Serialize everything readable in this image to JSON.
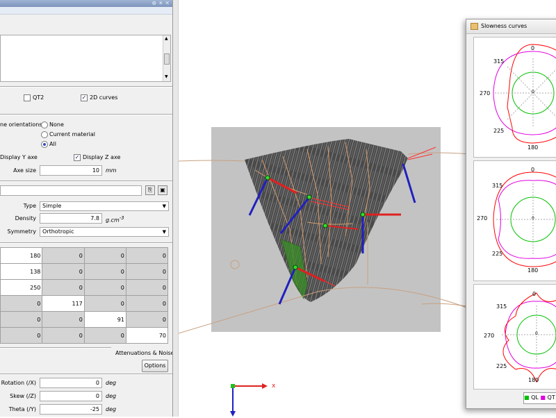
{
  "left_panel": {
    "titlebar_buttons": "⊕ ☀ ✕",
    "curves": {
      "qt2": "QT2",
      "curves_2d": "2D curves"
    },
    "orientations": {
      "label": "ne orientations",
      "none": "None",
      "current": "Current material",
      "all": "All"
    },
    "display": {
      "y": "Display Y axe",
      "z": "Display Z axe"
    },
    "axe_size": {
      "label": "Axe size",
      "value": "10",
      "unit": "mm"
    },
    "material": {
      "type_label": "Type",
      "type_value": "Simple",
      "density_label": "Density",
      "density_value": "7.8",
      "density_unit": "g.cm",
      "symmetry_label": "Symmetry",
      "symmetry_value": "Orthotropic"
    },
    "matrix": [
      [
        "180",
        "0",
        "0",
        "0"
      ],
      [
        "138",
        "0",
        "0",
        "0"
      ],
      [
        "250",
        "0",
        "0",
        "0"
      ],
      [
        "0",
        "117",
        "0",
        "0"
      ],
      [
        "0",
        "0",
        "91",
        "0"
      ],
      [
        "0",
        "0",
        "0",
        "70"
      ]
    ],
    "attenuations_label": "Attenuations & Noise",
    "options_button": "Options",
    "rotation": {
      "label": "Rotation (/X)",
      "value": "0",
      "unit": "deg"
    },
    "skew": {
      "label": "Skew (/Z)",
      "value": "0",
      "unit": "deg"
    },
    "theta": {
      "label": "Theta (/Y)",
      "value": "-25",
      "unit": "deg"
    }
  },
  "viewport": {
    "axis_x_label": "x"
  },
  "slowness": {
    "title": "Slowness curves",
    "plots": [
      {
        "top": "0",
        "nw": "315",
        "w": "270",
        "sw": "225",
        "bottom": "180",
        "center": "0"
      },
      {
        "top": "0",
        "nw": "315",
        "w": "270",
        "sw": "225",
        "bottom": "180",
        "center": "0"
      },
      {
        "top": "0",
        "nw": "315",
        "w": "270",
        "sw": "225",
        "bottom": "180",
        "center": "0"
      }
    ],
    "legend": {
      "ql": "QL",
      "qt": "QT"
    },
    "colors": {
      "ql": "#00c000",
      "qt1": "#e000e0",
      "qt2": "#ff0000"
    }
  }
}
